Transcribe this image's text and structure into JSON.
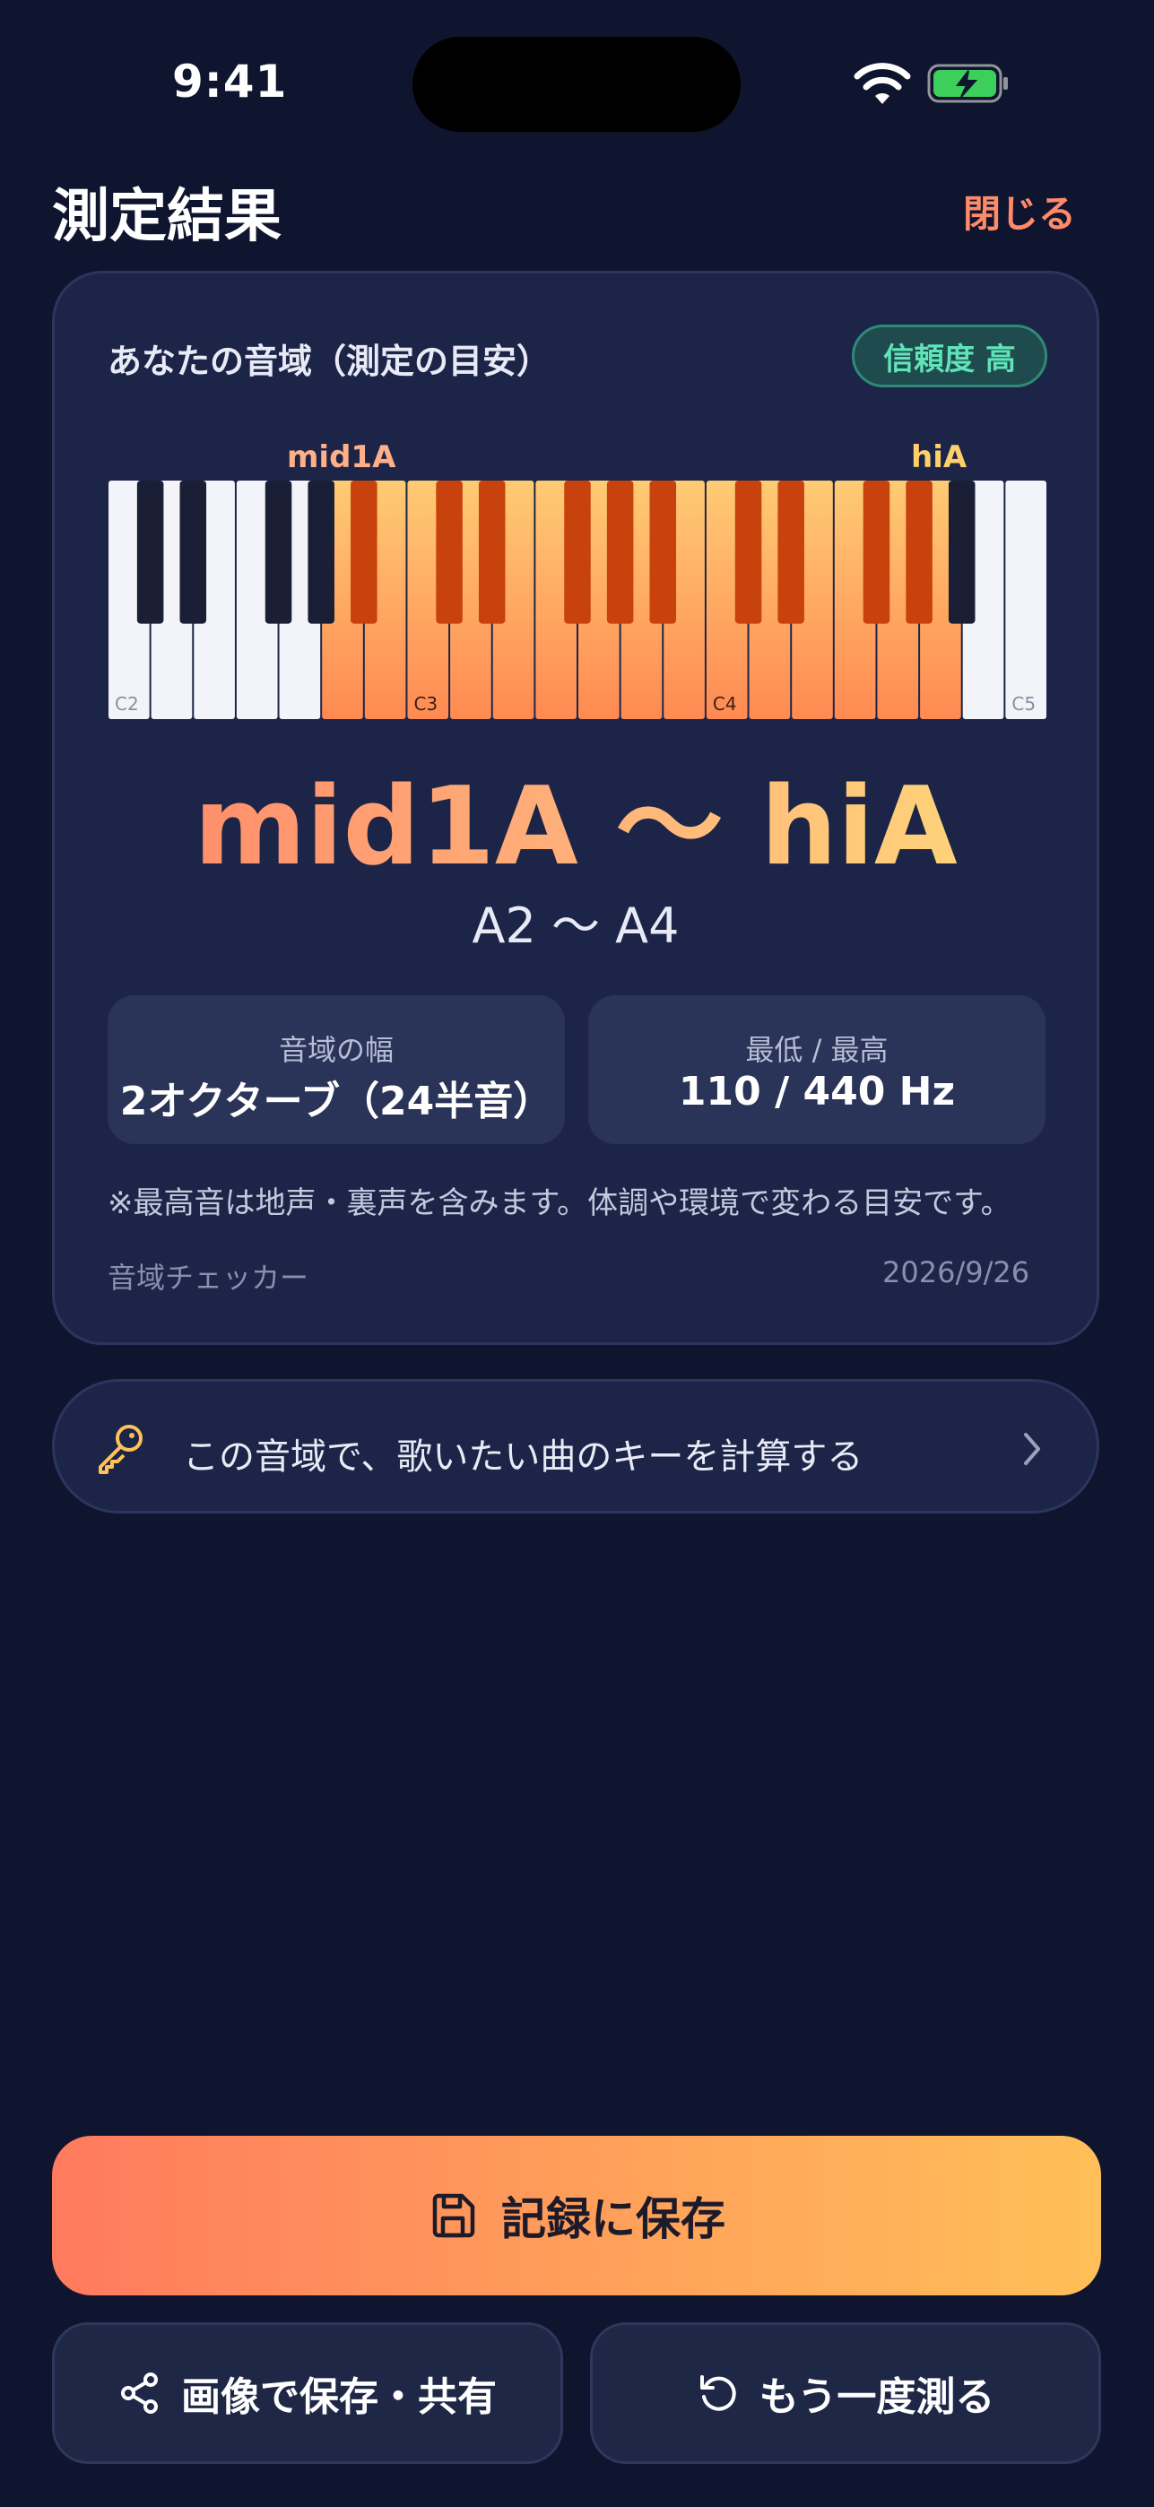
{
  "status_bar": {
    "time": "9:41"
  },
  "header": {
    "title": "測定結果",
    "close_label": "閉じる"
  },
  "result_card": {
    "label": "あなたの音域（測定の目安）",
    "confidence_badge": "信頼度 高",
    "markers": {
      "low": "mid1A",
      "high": "hiA"
    },
    "keyboard": {
      "white_key_labels": {
        "0": "C2",
        "7": "C3",
        "14": "C4",
        "21": "C5"
      },
      "highlight_from_white": 5,
      "highlight_to_white": 19,
      "total_white_keys": 22
    },
    "range_main": "mid1A 〜 hiA",
    "range_sub": "A2 〜 A4",
    "stats": [
      {
        "label": "音域の幅",
        "value": "2オクターブ（24半音）"
      },
      {
        "label": "最低 / 最高",
        "value": "110 / 440 Hz"
      }
    ],
    "note": "※最高音は地声・裏声を含みます。体調や環境で変わる目安です。",
    "app_name": "音域チェッカー",
    "date": "2026/9/26"
  },
  "key_calc": {
    "label": "この音域で、歌いたい曲のキーを計算する",
    "icon": "key-icon"
  },
  "actions": {
    "save_label": "記録に保存",
    "share_label": "画像で保存・共有",
    "again_label": "もう一度測る"
  },
  "colors": {
    "background": "#10152f",
    "card": "#1c2548",
    "accent_start": "#ff7a5e",
    "accent_end": "#ffbf58",
    "badge_green": "#5fe3b7",
    "close_color": "#ff8a6a"
  }
}
